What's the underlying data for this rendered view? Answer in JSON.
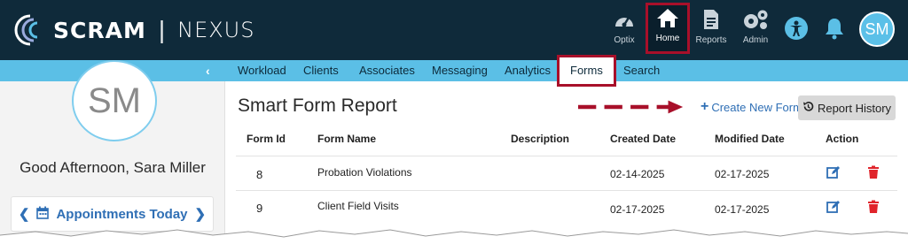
{
  "brand": {
    "name": "SCRAM",
    "product": "NEXUS"
  },
  "top_nav": [
    {
      "id": "optix",
      "label": "Optix",
      "icon": "gauge-icon"
    },
    {
      "id": "home",
      "label": "Home",
      "icon": "home-icon",
      "active": true
    },
    {
      "id": "reports",
      "label": "Reports",
      "icon": "document-icon"
    },
    {
      "id": "admin",
      "label": "Admin",
      "icon": "gears-icon"
    }
  ],
  "user": {
    "initials": "SM",
    "greeting": "Good Afternoon, Sara Miller"
  },
  "appointments_button": "Appointments Today",
  "tabs": [
    "Workload",
    "Clients",
    "Associates",
    "Messaging",
    "Analytics",
    "Forms",
    "Search"
  ],
  "active_tab": "Forms",
  "page_title": "Smart Form Report",
  "create_new_form": "Create New Form",
  "report_history": "Report History",
  "table": {
    "headers": [
      "Form Id",
      "Form Name",
      "Description",
      "Created Date",
      "Modified Date",
      "Action"
    ],
    "rows": [
      {
        "id": "8",
        "name": "Probation Violations",
        "description": "",
        "created": "02-14-2025",
        "modified": "02-17-2025"
      },
      {
        "id": "9",
        "name": "Client Field Visits",
        "description": "",
        "created": "02-17-2025",
        "modified": "02-17-2025"
      }
    ]
  },
  "colors": {
    "topbar": "#0f2a3a",
    "subnav": "#5bbfe6",
    "highlight": "#a8102a",
    "link": "#2f6fb5",
    "delete": "#e0242b"
  }
}
